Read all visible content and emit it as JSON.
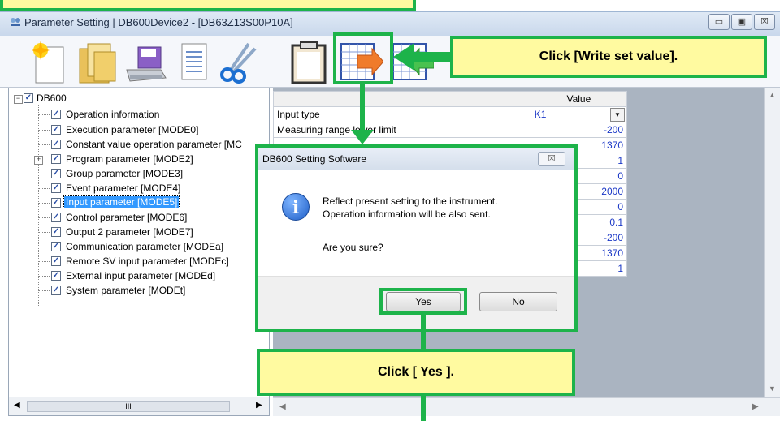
{
  "window": {
    "title": "Parameter Setting | DB600Device2 - [DB63Z13S00P10A]",
    "controls": [
      "▭",
      "▣",
      "☒"
    ]
  },
  "toolbar": {
    "items": [
      "new-icon",
      "open-folder-icon",
      "save-icon",
      "copy-document-icon",
      "cut-icon",
      "paste-icon",
      "write-set-value-icon",
      "read-set-value-icon"
    ]
  },
  "tree": {
    "root": "DB600",
    "items": [
      "Operation information",
      "Execution parameter [MODE0]",
      "Constant value operation parameter [MC",
      "Program parameter [MODE2]",
      "Group parameter [MODE3]",
      "Event parameter [MODE4]",
      "Input parameter [MODE5]",
      "Control parameter [MODE6]",
      "Output 2 parameter [MODE7]",
      "Communication parameter [MODEa]",
      "Remote SV input parameter [MODEc]",
      "External input parameter [MODEd]",
      "System parameter [MODEt]"
    ],
    "selected_index": 6
  },
  "grid": {
    "header": "Value",
    "rows": [
      {
        "name": "Input type",
        "value": "K1"
      },
      {
        "name": "Measuring range lower limit",
        "value": "-200"
      },
      {
        "name": "",
        "value": "1370"
      },
      {
        "name": "",
        "value": "1"
      },
      {
        "name": "",
        "value": "0"
      },
      {
        "name": "",
        "value": "2000"
      },
      {
        "name": "",
        "value": "0"
      },
      {
        "name": "",
        "value": "0.1"
      },
      {
        "name": "",
        "value": "-200"
      },
      {
        "name": "",
        "value": "1370"
      },
      {
        "name": "",
        "value": "1"
      }
    ]
  },
  "dialog": {
    "title": "DB600 Setting Software",
    "close": "☒",
    "line1": "Reflect present setting to the instrument.",
    "line2": "Operation information will be also sent.",
    "question": "Are you sure?",
    "yes": "Yes",
    "no": "No"
  },
  "callouts": {
    "write": "Click [Write set value].",
    "yes": "Click [ Yes ]."
  },
  "colors": {
    "annotation_green": "#1db34a",
    "callout_yellow": "#fffaa0",
    "selection_blue": "#3399ff",
    "value_blue": "#1a37c6"
  }
}
